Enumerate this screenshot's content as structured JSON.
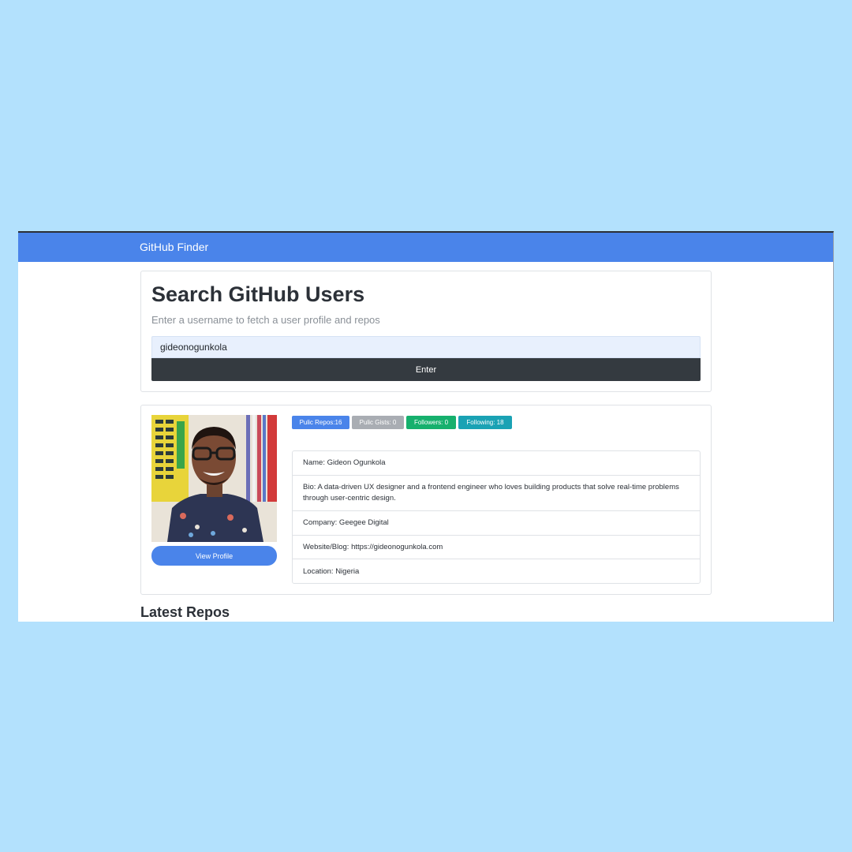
{
  "navbar": {
    "brand": "GitHub Finder"
  },
  "search": {
    "title": "Search GitHub Users",
    "subtitle": "Enter a username to fetch a user profile and repos",
    "input_value": "gideonogunkola",
    "button_label": "Enter"
  },
  "profile": {
    "view_profile_label": "View Profile",
    "badges": {
      "repos": "Pulic Repos:16",
      "gists": "Pulic Gists: 0",
      "followers": "Followers: 0",
      "following": "Following: 18"
    },
    "info": {
      "name": "Name: Gideon Ogunkola",
      "bio": "Bio: A data-driven UX designer and a frontend engineer who loves building products that solve real-time problems through user-centric design.",
      "company": "Company: Geegee Digital",
      "website": "Website/Blog: https://gideonogunkola.com",
      "location": "Location: Nigeria"
    }
  },
  "repos": {
    "heading": "Latest Repos"
  },
  "colors": {
    "page_background": "#b3e1fd",
    "navbar": "#4a84ea",
    "enter_button": "#343a40",
    "badge_repos": "#4a84ea",
    "badge_gists": "#a9adb3",
    "badge_followers": "#16b06d",
    "badge_following": "#1aa2b4"
  }
}
